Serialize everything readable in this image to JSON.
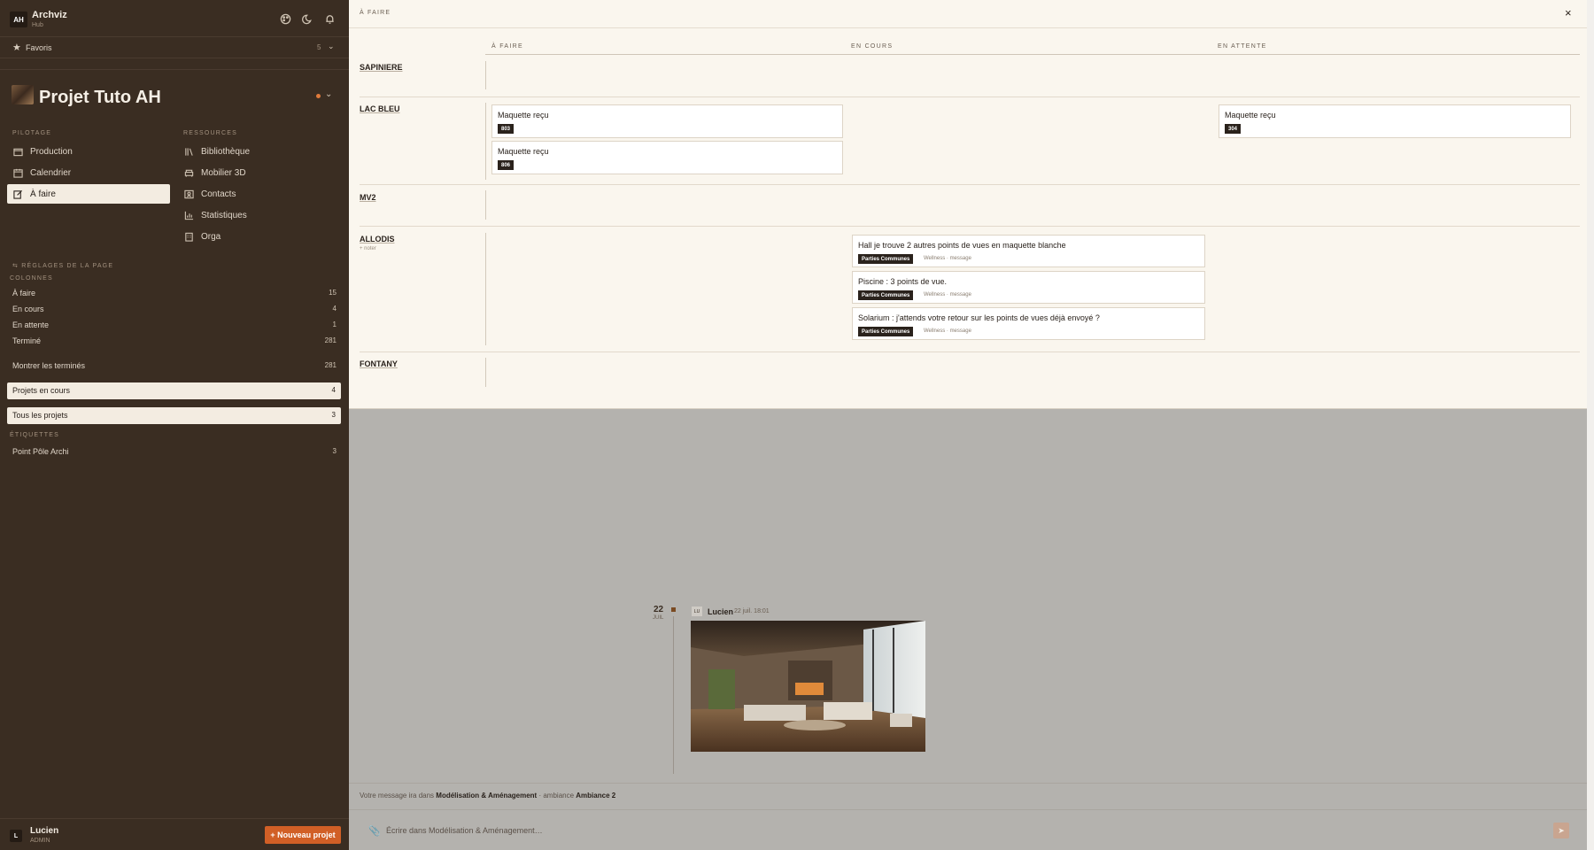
{
  "app": {
    "logo": "AH",
    "name": "Archviz",
    "subtitle": "Hub"
  },
  "favorites": {
    "label": "Favoris",
    "count": "5"
  },
  "project": {
    "title": "Projet Tuto AH"
  },
  "nav": {
    "pilotage_label": "PILOTAGE",
    "pilotage": [
      {
        "label": "Production",
        "icon": "folder-icon"
      },
      {
        "label": "Calendrier",
        "icon": "calendar-icon"
      },
      {
        "label": "À faire",
        "icon": "edit-icon",
        "active": true
      }
    ],
    "ressources_label": "RESSOURCES",
    "ressources": [
      {
        "label": "Bibliothèque",
        "icon": "library-icon"
      },
      {
        "label": "Mobilier 3D",
        "icon": "furniture-icon"
      },
      {
        "label": "Contacts",
        "icon": "contacts-icon"
      },
      {
        "label": "Statistiques",
        "icon": "chart-icon"
      },
      {
        "label": "Orga",
        "icon": "building-icon"
      }
    ]
  },
  "page_settings": {
    "label": "RÉGLAGES DE LA PAGE",
    "columns_label": "COLONNES",
    "columns": [
      {
        "label": "À faire",
        "count": "15"
      },
      {
        "label": "En cours",
        "count": "4"
      },
      {
        "label": "En attente",
        "count": "1"
      },
      {
        "label": "Terminé",
        "count": "281"
      }
    ],
    "show_done": {
      "label": "Montrer les terminés",
      "count": "281"
    },
    "projects_current": {
      "label": "Projets en cours",
      "count": "4"
    },
    "projects_all": {
      "label": "Tous les projets",
      "count": "3"
    },
    "tags_label": "ÉTIQUETTES",
    "tags": [
      {
        "label": "Point Pôle Archi",
        "count": "3"
      }
    ]
  },
  "user": {
    "initial": "L",
    "name": "Lucien",
    "role": "ADMIN",
    "new_project": "+ Nouveau projet"
  },
  "board": {
    "title": "À FAIRE",
    "close": "×",
    "columns": [
      "À FAIRE",
      "EN COURS",
      "EN ATTENTE"
    ],
    "rows": [
      {
        "name": "SAPINIERE"
      },
      {
        "name": "LAC BLEU"
      },
      {
        "name": "MV2"
      },
      {
        "name": "ALLODIS",
        "sub": "+ noter"
      },
      {
        "name": "FONTANY"
      }
    ],
    "cards": [
      {
        "title": "Maquette reçu",
        "badge": "803"
      },
      {
        "title": "Maquette reçu",
        "badge": "806"
      },
      {
        "title": "Maquette reçu",
        "badge": "304"
      },
      {
        "title": "Hall je trouve 2 autres points de vues en maquette blanche",
        "badge": "Parties Communes",
        "meta": "Wellness · message"
      },
      {
        "title": "Piscine : 3 points de vue.",
        "badge": "Parties Communes",
        "meta": "Wellness · message"
      },
      {
        "title": "Solarium : j'attends votre retour sur les points de vues déjà envoyé ?",
        "badge": "Parties Communes",
        "meta": "Wellness · message"
      }
    ]
  },
  "timeline": {
    "day": "22",
    "month": "JUIL",
    "author_initials": "LU",
    "author": "Lucien",
    "date": "22 juil. 18:01"
  },
  "info": {
    "prefix": "Votre message ira dans",
    "channel": "Modélisation & Aménagement",
    "middle": "· ambiance",
    "ambiance": "Ambiance 2"
  },
  "compose": {
    "placeholder": "Écrire dans Modélisation & Aménagement…"
  },
  "colors": {
    "sidebar": "#3a2d22",
    "accent": "#d15f26",
    "overlay_bg": "#faf6ee",
    "badge": "#2a221c"
  }
}
